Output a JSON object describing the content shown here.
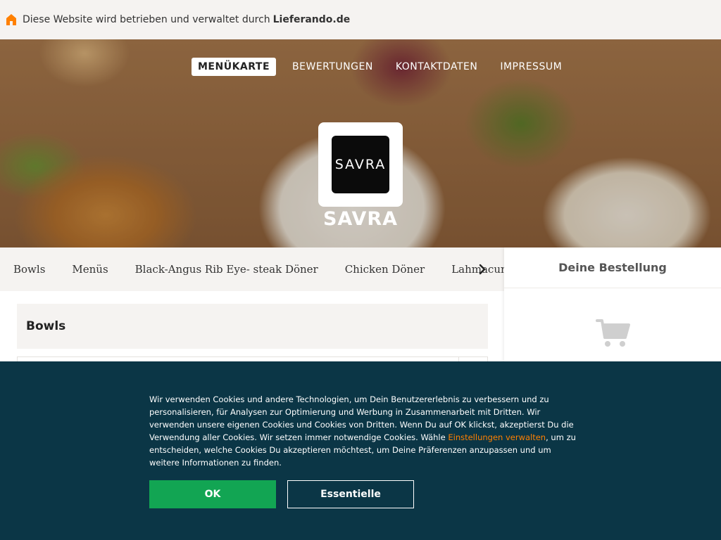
{
  "topbar": {
    "prefix": "Diese Website wird betrieben und verwaltet durch",
    "brand": "Lieferando.de",
    "icon": "house-icon",
    "icon_color": "#ff8000"
  },
  "hero": {
    "nav": [
      {
        "label": "MENÜKARTE",
        "active": true
      },
      {
        "label": "BEWERTUNGEN",
        "active": false
      },
      {
        "label": "KONTAKTDATEN",
        "active": false
      },
      {
        "label": "IMPRESSUM",
        "active": false
      }
    ],
    "logo_text": "SAVRA",
    "restaurant_name": "SAVRA"
  },
  "categories": {
    "items": [
      "Bowls",
      "Menüs",
      "Black-Angus Rib Eye- steak Döner",
      "Chicken Döner",
      "Lahmacun"
    ],
    "next_icon": "chevron-right-icon"
  },
  "menu": {
    "section_title": "Bowls"
  },
  "sidebar": {
    "title": "Deine Bestellung",
    "icon": "cart-icon"
  },
  "cookie": {
    "text_before": "Wir verwenden Cookies und andere Technologien, um Dein Benutzererlebnis zu verbessern und zu personalisieren, für Analysen zur Optimierung und Werbung in Zusammenarbeit mit Dritten. Wir verwenden unsere eigenen Cookies und Cookies von Dritten. Wenn Du auf OK klickst, akzeptierst Du die Verwendung aller Cookies. Wir setzen immer notwendige Cookies. Wähle ",
    "link": "Einstellungen verwalten",
    "text_after": ", um zu entscheiden, welche Cookies Du akzeptieren möchtest, um Deine Präferenzen anzupassen und um weitere Informationen zu finden.",
    "ok_label": "OK",
    "essential_label": "Essentielle"
  },
  "colors": {
    "accent": "#ff8000",
    "cookie_bg": "#0b3646",
    "ok_green": "#12a553"
  }
}
